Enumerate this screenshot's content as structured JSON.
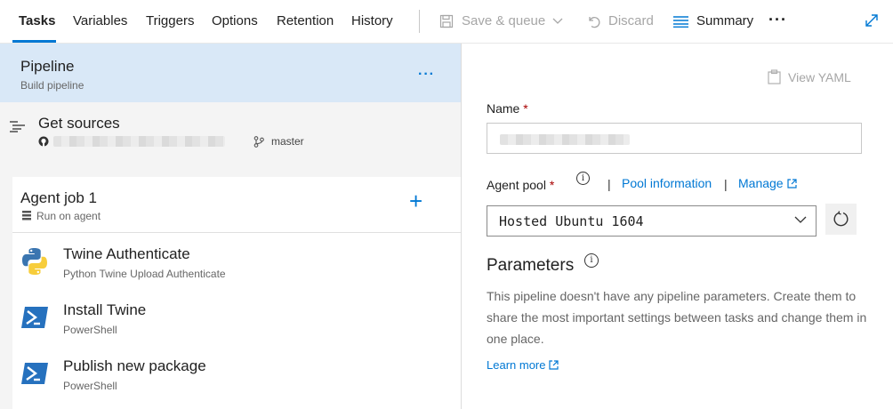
{
  "tabs": [
    {
      "label": "Tasks"
    },
    {
      "label": "Variables"
    },
    {
      "label": "Triggers"
    },
    {
      "label": "Options"
    },
    {
      "label": "Retention"
    },
    {
      "label": "History"
    }
  ],
  "toolbar": {
    "save_queue": "Save & queue",
    "discard": "Discard",
    "summary": "Summary",
    "more": "···"
  },
  "pipeline": {
    "title": "Pipeline",
    "subtitle": "Build pipeline",
    "more": "···"
  },
  "sources": {
    "title": "Get sources",
    "branch": "master"
  },
  "job": {
    "title": "Agent job 1",
    "subtitle": "Run on agent",
    "add": "+"
  },
  "tasks": [
    {
      "title": "Twine Authenticate",
      "subtitle": "Python Twine Upload Authenticate",
      "icon": "python-icon"
    },
    {
      "title": "Install Twine",
      "subtitle": "PowerShell",
      "icon": "powershell-icon"
    },
    {
      "title": "Publish new package",
      "subtitle": "PowerShell",
      "icon": "powershell-icon"
    }
  ],
  "details": {
    "view_yaml": "View YAML",
    "name_label": "Name",
    "required": "*",
    "name_value": "",
    "agent_pool_label": "Agent pool",
    "pool_info": "Pool information",
    "manage": "Manage",
    "separator": "|",
    "agent_pool_value": "Hosted Ubuntu 1604",
    "info_glyph": "i",
    "parameters_title": "Parameters",
    "parameters_desc": "This pipeline doesn't have any pipeline parameters. Create them to share the most important settings between tasks and change them in one place.",
    "learn_more": "Learn more"
  },
  "colors": {
    "accent": "#0078d4",
    "selected_row": "#d9e8f7",
    "required": "#a80000"
  }
}
